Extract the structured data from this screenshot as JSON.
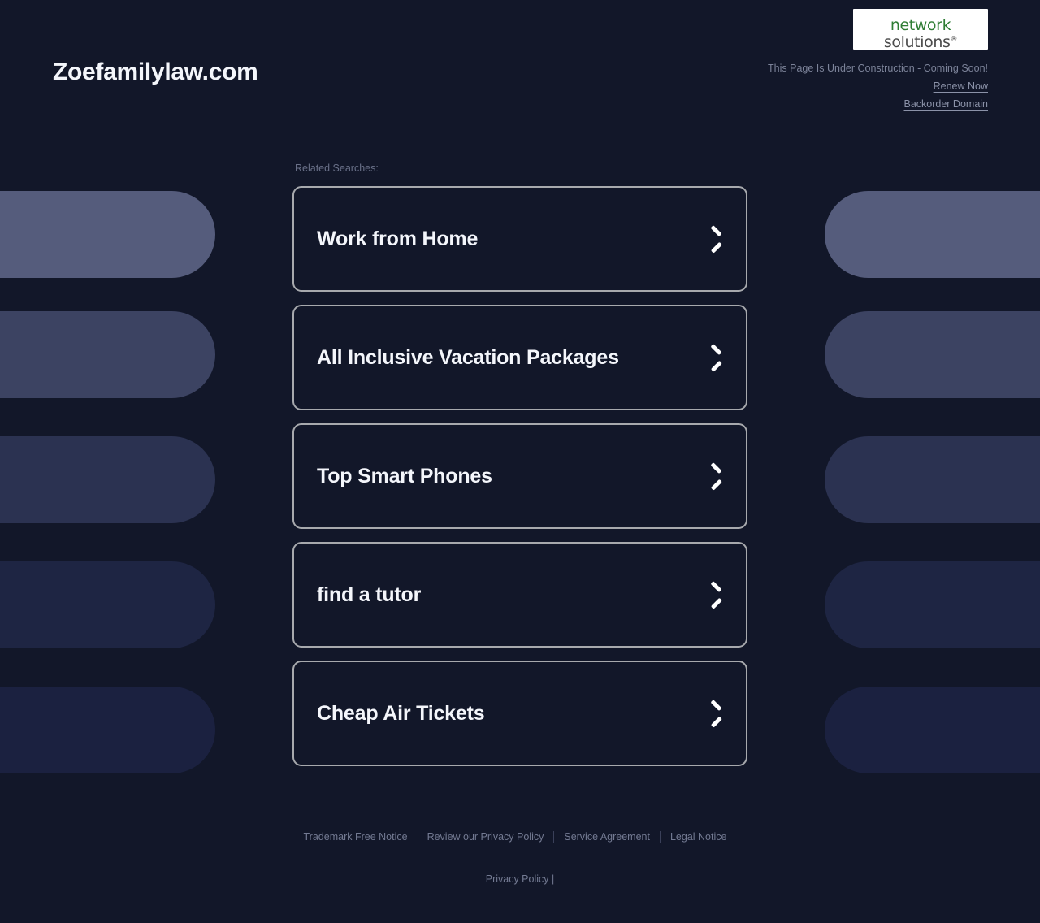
{
  "page": {
    "background_color": "#121729",
    "accent_color": "#a7a9ad"
  },
  "header": {
    "brand_title": "Zoefamilylaw.com",
    "logo": {
      "name": "network-solutions-logo",
      "line1": "network",
      "line2": "solutions",
      "registered_mark": "®",
      "line1_color": "#2f7d34",
      "line2_color": "#4a4a4a",
      "background_color": "#ffffff"
    },
    "construction_notice": "This Page Is Under Construction - Coming Soon!",
    "renew_link": "Renew Now",
    "backorder_link": "Backorder Domain"
  },
  "main": {
    "related_label": "Related Searches:",
    "cards": [
      {
        "label": "Work from Home",
        "icon": "chevron-right-icon"
      },
      {
        "label": "All Inclusive Vacation Packages",
        "icon": "chevron-right-icon"
      },
      {
        "label": "Top Smart Phones",
        "icon": "chevron-right-icon"
      },
      {
        "label": "find a tutor",
        "icon": "chevron-right-icon"
      },
      {
        "label": "Cheap Air Tickets",
        "icon": "chevron-right-icon"
      }
    ]
  },
  "footer": {
    "links": [
      "Trademark Free Notice",
      "Review our Privacy Policy",
      "Service Agreement",
      "Legal Notice"
    ],
    "bottom_text": "Privacy Policy |"
  }
}
